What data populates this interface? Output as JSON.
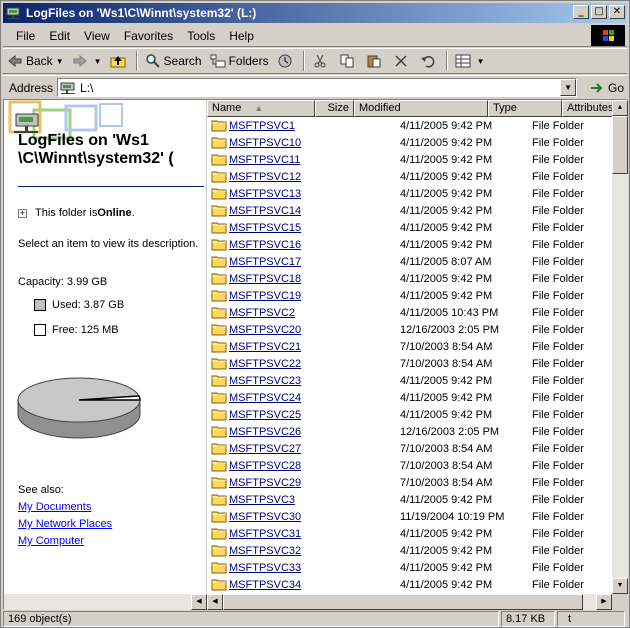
{
  "window": {
    "title": "LogFiles on 'Ws1\\C\\Winnt\\system32' (L:)",
    "controls": {
      "minimize": "_",
      "maximize": "□",
      "close": "✕"
    }
  },
  "menu": [
    "File",
    "Edit",
    "View",
    "Favorites",
    "Tools",
    "Help"
  ],
  "toolbar": {
    "back_label": "Back",
    "search_label": "Search",
    "folders_label": "Folders"
  },
  "address": {
    "label": "Address",
    "value": "L:\\",
    "go_label": "Go"
  },
  "left_pane": {
    "title_line1": "LogFiles on 'Ws1",
    "title_line2": "\\C\\Winnt\\system32' (",
    "online_prefix": "This folder is ",
    "online_status": "Online",
    "online_suffix": ".",
    "description": "Select an item to view its description.",
    "capacity": "Capacity: 3.99 GB",
    "used": "Used: 3.87 GB",
    "free": "Free: 125 MB",
    "used_fraction": 0.97,
    "see_also": "See also:",
    "links": [
      "My Documents",
      "My Network Places",
      "My Computer"
    ]
  },
  "columns": [
    "Name",
    "Size",
    "Modified",
    "Type",
    "Attributes"
  ],
  "files": [
    {
      "name": "MSFTPSVC1",
      "modified": "4/11/2005 9:42 PM",
      "type": "File Folder"
    },
    {
      "name": "MSFTPSVC10",
      "modified": "4/11/2005 9:42 PM",
      "type": "File Folder"
    },
    {
      "name": "MSFTPSVC11",
      "modified": "4/11/2005 9:42 PM",
      "type": "File Folder"
    },
    {
      "name": "MSFTPSVC12",
      "modified": "4/11/2005 9:42 PM",
      "type": "File Folder"
    },
    {
      "name": "MSFTPSVC13",
      "modified": "4/11/2005 9:42 PM",
      "type": "File Folder"
    },
    {
      "name": "MSFTPSVC14",
      "modified": "4/11/2005 9:42 PM",
      "type": "File Folder"
    },
    {
      "name": "MSFTPSVC15",
      "modified": "4/11/2005 9:42 PM",
      "type": "File Folder"
    },
    {
      "name": "MSFTPSVC16",
      "modified": "4/11/2005 9:42 PM",
      "type": "File Folder"
    },
    {
      "name": "MSFTPSVC17",
      "modified": "4/11/2005 8:07 AM",
      "type": "File Folder"
    },
    {
      "name": "MSFTPSVC18",
      "modified": "4/11/2005 9:42 PM",
      "type": "File Folder"
    },
    {
      "name": "MSFTPSVC19",
      "modified": "4/11/2005 9:42 PM",
      "type": "File Folder"
    },
    {
      "name": "MSFTPSVC2",
      "modified": "4/11/2005 10:43 PM",
      "type": "File Folder"
    },
    {
      "name": "MSFTPSVC20",
      "modified": "12/16/2003 2:05 PM",
      "type": "File Folder"
    },
    {
      "name": "MSFTPSVC21",
      "modified": "7/10/2003 8:54 AM",
      "type": "File Folder"
    },
    {
      "name": "MSFTPSVC22",
      "modified": "7/10/2003 8:54 AM",
      "type": "File Folder"
    },
    {
      "name": "MSFTPSVC23",
      "modified": "4/11/2005 9:42 PM",
      "type": "File Folder"
    },
    {
      "name": "MSFTPSVC24",
      "modified": "4/11/2005 9:42 PM",
      "type": "File Folder"
    },
    {
      "name": "MSFTPSVC25",
      "modified": "4/11/2005 9:42 PM",
      "type": "File Folder"
    },
    {
      "name": "MSFTPSVC26",
      "modified": "12/16/2003 2:05 PM",
      "type": "File Folder"
    },
    {
      "name": "MSFTPSVC27",
      "modified": "7/10/2003 8:54 AM",
      "type": "File Folder"
    },
    {
      "name": "MSFTPSVC28",
      "modified": "7/10/2003 8:54 AM",
      "type": "File Folder"
    },
    {
      "name": "MSFTPSVC29",
      "modified": "7/10/2003 8:54 AM",
      "type": "File Folder"
    },
    {
      "name": "MSFTPSVC3",
      "modified": "4/11/2005 9:42 PM",
      "type": "File Folder"
    },
    {
      "name": "MSFTPSVC30",
      "modified": "11/19/2004 10:19 PM",
      "type": "File Folder"
    },
    {
      "name": "MSFTPSVC31",
      "modified": "4/11/2005 9:42 PM",
      "type": "File Folder"
    },
    {
      "name": "MSFTPSVC32",
      "modified": "4/11/2005 9:42 PM",
      "type": "File Folder"
    },
    {
      "name": "MSFTPSVC33",
      "modified": "4/11/2005 9:42 PM",
      "type": "File Folder"
    },
    {
      "name": "MSFTPSVC34",
      "modified": "4/11/2005 9:42 PM",
      "type": "File Folder"
    }
  ],
  "status": {
    "count": "169 object(s)",
    "size": "8.17 KB",
    "extra": "t"
  },
  "icons": {
    "folder": "folder-icon",
    "back": "back-arrow-icon",
    "forward": "forward-arrow-icon",
    "up": "up-folder-icon",
    "search": "search-icon",
    "folders": "folders-icon",
    "history": "history-icon",
    "cut": "cut-icon",
    "copy": "copy-icon",
    "paste": "paste-icon",
    "delete": "delete-icon",
    "undo": "undo-icon",
    "views": "views-icon"
  },
  "colors": {
    "titlebar_start": "#0a246a",
    "titlebar_end": "#a6caf0",
    "link": "#0000ff",
    "folder_yellow": "#ffd75a"
  }
}
